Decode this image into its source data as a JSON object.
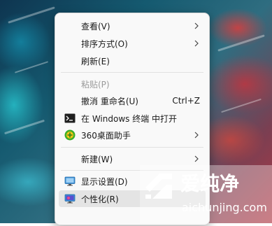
{
  "menu": {
    "items": [
      {
        "label": "查看(V)",
        "submenu": true
      },
      {
        "label": "排序方式(O)",
        "submenu": true
      },
      {
        "label": "刷新(E)"
      },
      {
        "label": "粘贴(P)",
        "disabled": true
      },
      {
        "label": "撤消 重命名(U)",
        "shortcut": "Ctrl+Z"
      },
      {
        "label": "在 Windows 终端 中打开",
        "icon": "terminal-icon"
      },
      {
        "label": "360桌面助手",
        "icon": "360-assistant-icon",
        "submenu": true
      },
      {
        "label": "新建(W)",
        "submenu": true
      },
      {
        "label": "显示设置(D)",
        "icon": "display-icon"
      },
      {
        "label": "个性化(R)",
        "icon": "personalize-icon",
        "selected": true
      }
    ]
  },
  "watermark": {
    "title": "爱纯净",
    "url": "aichunjing.com"
  },
  "colors": {
    "menu_bg": "#f9f9f9",
    "selected_bg": "#e4e4e4",
    "disabled_text": "#9a9a9a"
  }
}
